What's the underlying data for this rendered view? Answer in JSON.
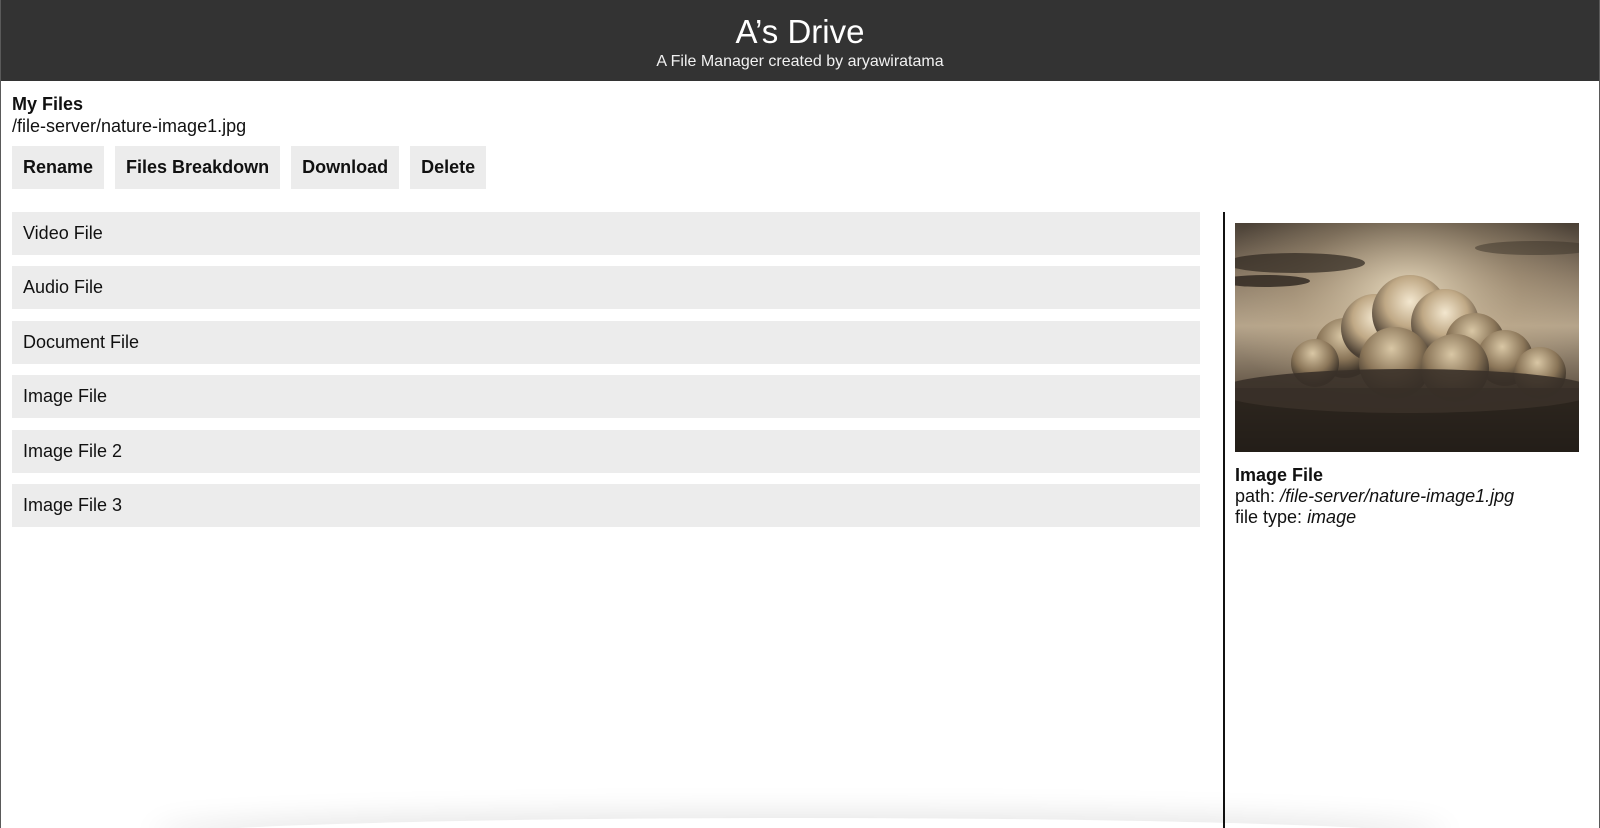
{
  "app": {
    "title": "A’s Drive",
    "subtitle": "A File Manager created by aryawiratama"
  },
  "breadcrumb": {
    "title": "My Files",
    "path": "/file-server/nature-image1.jpg"
  },
  "toolbar": {
    "rename_label": "Rename",
    "breakdown_label": "Files Breakdown",
    "download_label": "Download",
    "delete_label": "Delete"
  },
  "files": [
    {
      "label": "Video File"
    },
    {
      "label": "Audio File"
    },
    {
      "label": "Document File"
    },
    {
      "label": "Image File"
    },
    {
      "label": "Image File 2"
    },
    {
      "label": "Image File 3"
    }
  ],
  "preview": {
    "image_icon": "cloudy-sky-photo",
    "name": "Image File",
    "path_label": "path:",
    "path_value": "/file-server/nature-image1.jpg",
    "type_label": "file type:",
    "type_value": "image"
  },
  "colors": {
    "header_bg": "#333333",
    "row_bg": "#ececec",
    "divider": "#111111"
  }
}
